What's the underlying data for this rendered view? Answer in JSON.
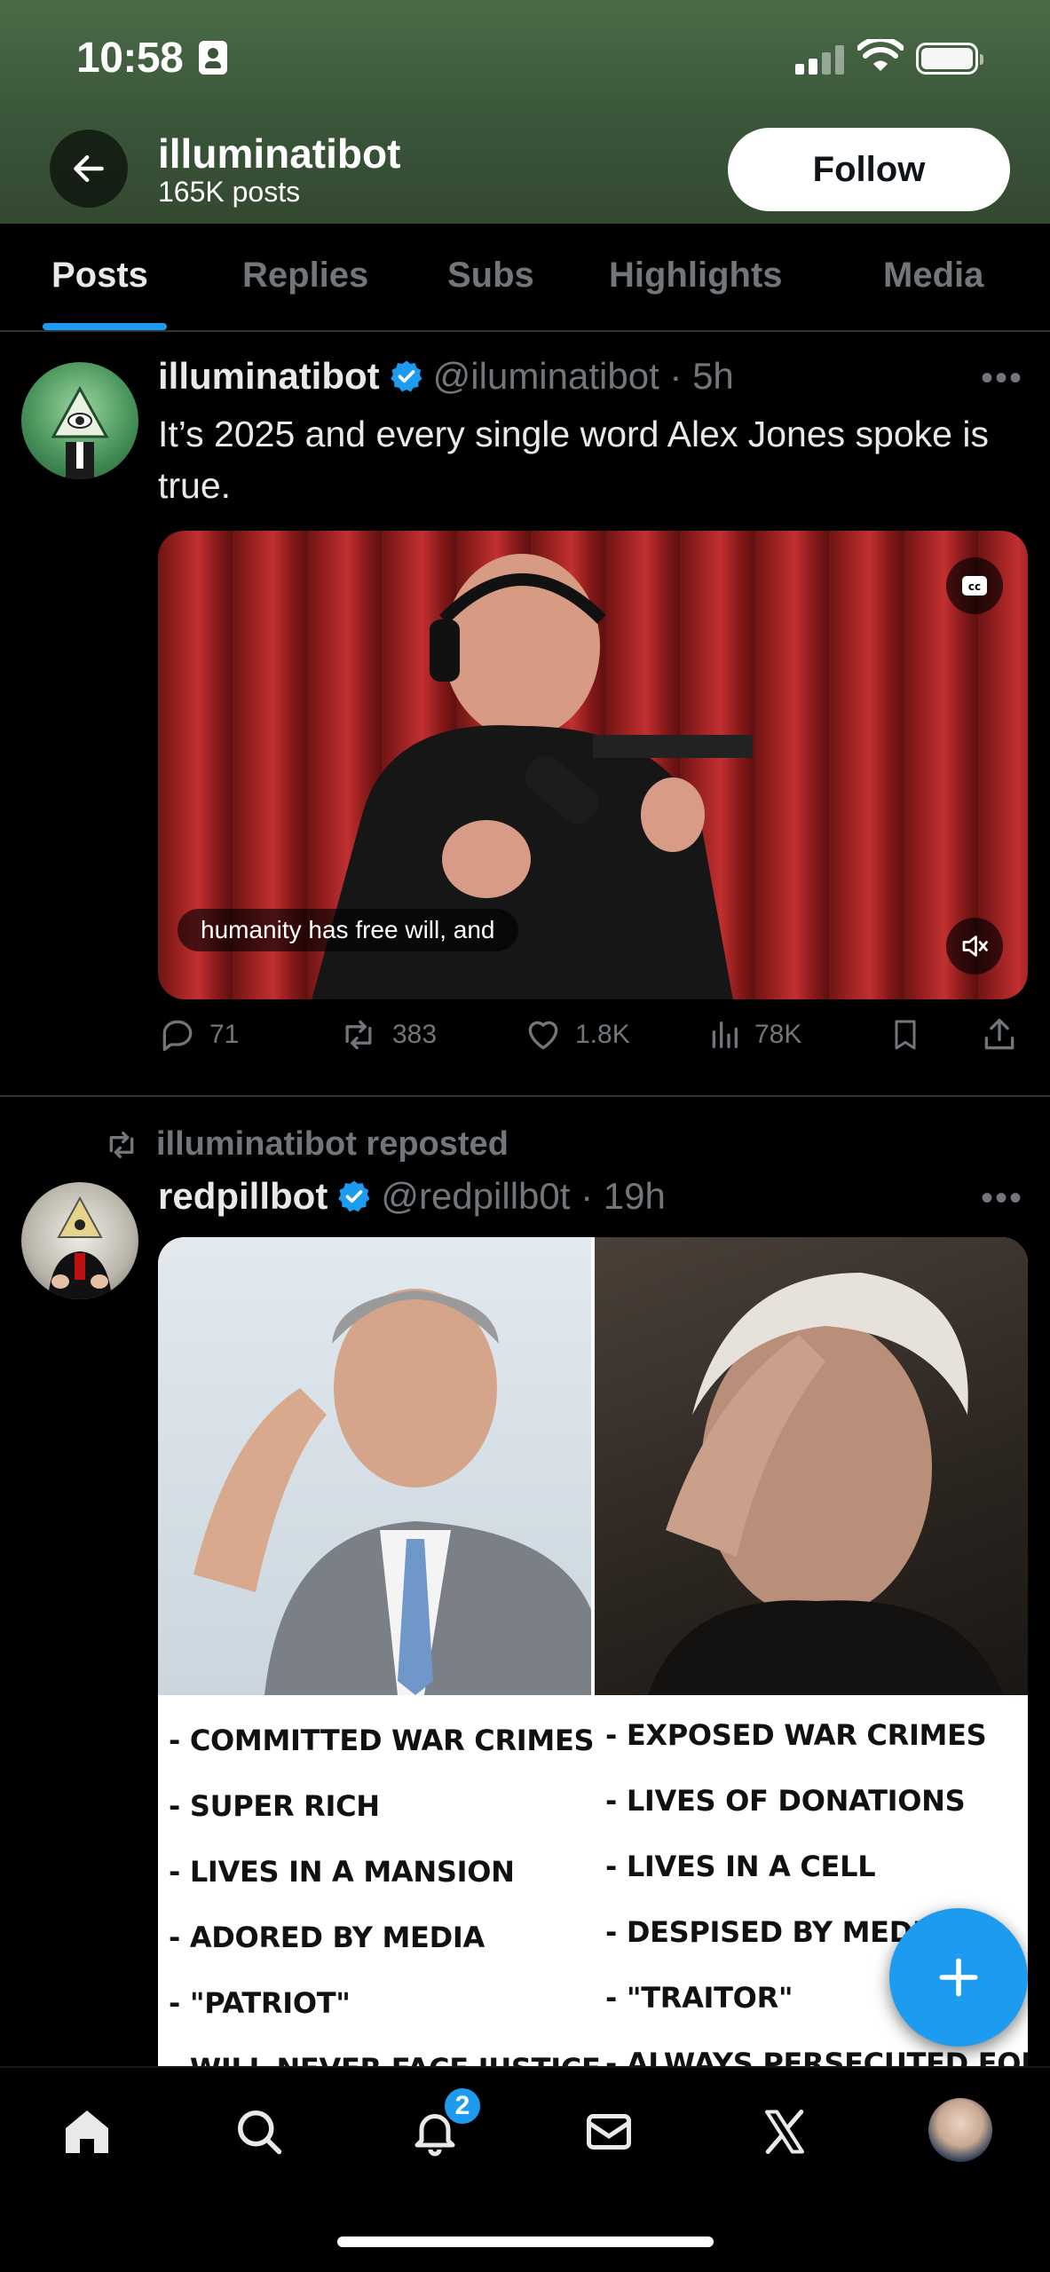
{
  "status_bar": {
    "time": "10:58"
  },
  "header": {
    "name": "illuminatibot",
    "post_count": "165K posts",
    "follow_label": "Follow"
  },
  "tabs": [
    {
      "label": "Posts",
      "active": true
    },
    {
      "label": "Replies",
      "active": false
    },
    {
      "label": "Subs",
      "active": false
    },
    {
      "label": "Highlights",
      "active": false
    },
    {
      "label": "Media",
      "active": false
    }
  ],
  "post1": {
    "name": "illuminatibot",
    "handle": "@iluminatibot",
    "time": "5h",
    "text": "It’s 2025 and every single word Alex Jones spoke is true.",
    "video_caption": "humanity has free will, and",
    "replies": "71",
    "reposts": "383",
    "likes": "1.8K",
    "views": "78K"
  },
  "post2": {
    "repost_label": "illuminatibot reposted",
    "name": "redpillbot",
    "handle": "@redpillb0t",
    "time": "19h",
    "meme_left": [
      "- COMMITTED WAR CRIMES",
      "- SUPER RICH",
      "- LIVES IN A MANSION",
      "- ADORED BY MEDIA",
      "- \"PATRIOT\"",
      "- WILL NEVER FACE JUSTICE"
    ],
    "meme_right": [
      "- EXPOSED WAR CRIMES",
      "- LIVES OF DONATIONS",
      "- LIVES IN A CELL",
      "- DESPISED BY MEDIA",
      "- \"TRAITOR\"",
      "- ALWAYS PERSECUTED FOR"
    ]
  },
  "bottom_nav": {
    "items": [
      "home-icon",
      "search-icon",
      "bell-icon",
      "mail-icon",
      "x-logo-icon",
      "avatar"
    ],
    "notification_count": "2"
  },
  "colors": {
    "accent": "#1d9bf0",
    "muted": "#71767b",
    "text": "#e7e9ea",
    "header_bg": "#3a5539"
  }
}
